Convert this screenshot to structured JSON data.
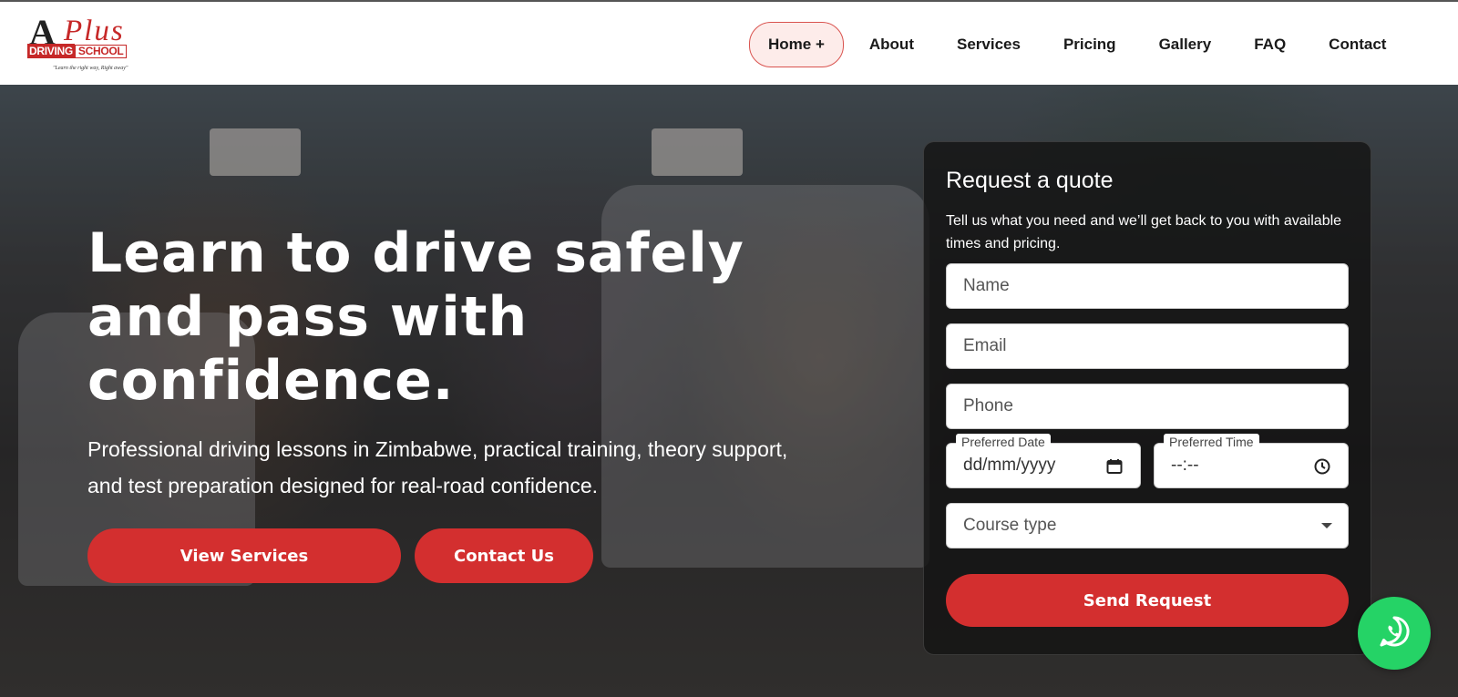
{
  "logo": {
    "letter": "A",
    "plus": "Plus",
    "driving": "DRIVING",
    "school": "SCHOOL",
    "tagline": "\"Learn the right way, Right away\""
  },
  "nav": {
    "items": [
      {
        "label": "Home +"
      },
      {
        "label": "About"
      },
      {
        "label": "Services"
      },
      {
        "label": "Pricing"
      },
      {
        "label": "Gallery"
      },
      {
        "label": "FAQ"
      },
      {
        "label": "Contact"
      }
    ]
  },
  "hero": {
    "title": "Learn to drive safely and pass with confidence.",
    "subtitle": "Professional driving lessons in Zimbabwe, practical training, theory support, and test preparation designed for real-road confidence.",
    "primary_button": "View Services",
    "secondary_button": "Contact Us"
  },
  "quote_form": {
    "title": "Request a quote",
    "description": "Tell us what you need and we’ll get back to you with available times and pricing.",
    "name_placeholder": "Name",
    "email_placeholder": "Email",
    "phone_placeholder": "Phone",
    "date_label": "Preferred Date",
    "date_value": "dd/mm/yyyy",
    "time_label": "Preferred Time",
    "time_value": "--:--",
    "course_placeholder": "Course type",
    "submit_label": "Send Request"
  },
  "colors": {
    "accent": "#d32f2f",
    "whatsapp": "#25d366"
  },
  "icons": [
    "calendar-icon",
    "clock-icon",
    "chevron-down-icon",
    "whatsapp-icon"
  ]
}
